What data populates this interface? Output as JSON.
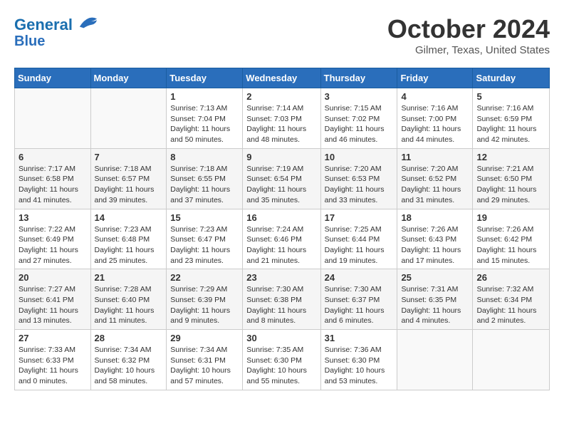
{
  "header": {
    "logo_line1": "General",
    "logo_line2": "Blue",
    "month": "October 2024",
    "location": "Gilmer, Texas, United States"
  },
  "weekdays": [
    "Sunday",
    "Monday",
    "Tuesday",
    "Wednesday",
    "Thursday",
    "Friday",
    "Saturday"
  ],
  "weeks": [
    [
      {
        "day": "",
        "info": ""
      },
      {
        "day": "",
        "info": ""
      },
      {
        "day": "1",
        "info": "Sunrise: 7:13 AM\nSunset: 7:04 PM\nDaylight: 11 hours and 50 minutes."
      },
      {
        "day": "2",
        "info": "Sunrise: 7:14 AM\nSunset: 7:03 PM\nDaylight: 11 hours and 48 minutes."
      },
      {
        "day": "3",
        "info": "Sunrise: 7:15 AM\nSunset: 7:02 PM\nDaylight: 11 hours and 46 minutes."
      },
      {
        "day": "4",
        "info": "Sunrise: 7:16 AM\nSunset: 7:00 PM\nDaylight: 11 hours and 44 minutes."
      },
      {
        "day": "5",
        "info": "Sunrise: 7:16 AM\nSunset: 6:59 PM\nDaylight: 11 hours and 42 minutes."
      }
    ],
    [
      {
        "day": "6",
        "info": "Sunrise: 7:17 AM\nSunset: 6:58 PM\nDaylight: 11 hours and 41 minutes."
      },
      {
        "day": "7",
        "info": "Sunrise: 7:18 AM\nSunset: 6:57 PM\nDaylight: 11 hours and 39 minutes."
      },
      {
        "day": "8",
        "info": "Sunrise: 7:18 AM\nSunset: 6:55 PM\nDaylight: 11 hours and 37 minutes."
      },
      {
        "day": "9",
        "info": "Sunrise: 7:19 AM\nSunset: 6:54 PM\nDaylight: 11 hours and 35 minutes."
      },
      {
        "day": "10",
        "info": "Sunrise: 7:20 AM\nSunset: 6:53 PM\nDaylight: 11 hours and 33 minutes."
      },
      {
        "day": "11",
        "info": "Sunrise: 7:20 AM\nSunset: 6:52 PM\nDaylight: 11 hours and 31 minutes."
      },
      {
        "day": "12",
        "info": "Sunrise: 7:21 AM\nSunset: 6:50 PM\nDaylight: 11 hours and 29 minutes."
      }
    ],
    [
      {
        "day": "13",
        "info": "Sunrise: 7:22 AM\nSunset: 6:49 PM\nDaylight: 11 hours and 27 minutes."
      },
      {
        "day": "14",
        "info": "Sunrise: 7:23 AM\nSunset: 6:48 PM\nDaylight: 11 hours and 25 minutes."
      },
      {
        "day": "15",
        "info": "Sunrise: 7:23 AM\nSunset: 6:47 PM\nDaylight: 11 hours and 23 minutes."
      },
      {
        "day": "16",
        "info": "Sunrise: 7:24 AM\nSunset: 6:46 PM\nDaylight: 11 hours and 21 minutes."
      },
      {
        "day": "17",
        "info": "Sunrise: 7:25 AM\nSunset: 6:44 PM\nDaylight: 11 hours and 19 minutes."
      },
      {
        "day": "18",
        "info": "Sunrise: 7:26 AM\nSunset: 6:43 PM\nDaylight: 11 hours and 17 minutes."
      },
      {
        "day": "19",
        "info": "Sunrise: 7:26 AM\nSunset: 6:42 PM\nDaylight: 11 hours and 15 minutes."
      }
    ],
    [
      {
        "day": "20",
        "info": "Sunrise: 7:27 AM\nSunset: 6:41 PM\nDaylight: 11 hours and 13 minutes."
      },
      {
        "day": "21",
        "info": "Sunrise: 7:28 AM\nSunset: 6:40 PM\nDaylight: 11 hours and 11 minutes."
      },
      {
        "day": "22",
        "info": "Sunrise: 7:29 AM\nSunset: 6:39 PM\nDaylight: 11 hours and 9 minutes."
      },
      {
        "day": "23",
        "info": "Sunrise: 7:30 AM\nSunset: 6:38 PM\nDaylight: 11 hours and 8 minutes."
      },
      {
        "day": "24",
        "info": "Sunrise: 7:30 AM\nSunset: 6:37 PM\nDaylight: 11 hours and 6 minutes."
      },
      {
        "day": "25",
        "info": "Sunrise: 7:31 AM\nSunset: 6:35 PM\nDaylight: 11 hours and 4 minutes."
      },
      {
        "day": "26",
        "info": "Sunrise: 7:32 AM\nSunset: 6:34 PM\nDaylight: 11 hours and 2 minutes."
      }
    ],
    [
      {
        "day": "27",
        "info": "Sunrise: 7:33 AM\nSunset: 6:33 PM\nDaylight: 11 hours and 0 minutes."
      },
      {
        "day": "28",
        "info": "Sunrise: 7:34 AM\nSunset: 6:32 PM\nDaylight: 10 hours and 58 minutes."
      },
      {
        "day": "29",
        "info": "Sunrise: 7:34 AM\nSunset: 6:31 PM\nDaylight: 10 hours and 57 minutes."
      },
      {
        "day": "30",
        "info": "Sunrise: 7:35 AM\nSunset: 6:30 PM\nDaylight: 10 hours and 55 minutes."
      },
      {
        "day": "31",
        "info": "Sunrise: 7:36 AM\nSunset: 6:30 PM\nDaylight: 10 hours and 53 minutes."
      },
      {
        "day": "",
        "info": ""
      },
      {
        "day": "",
        "info": ""
      }
    ]
  ]
}
